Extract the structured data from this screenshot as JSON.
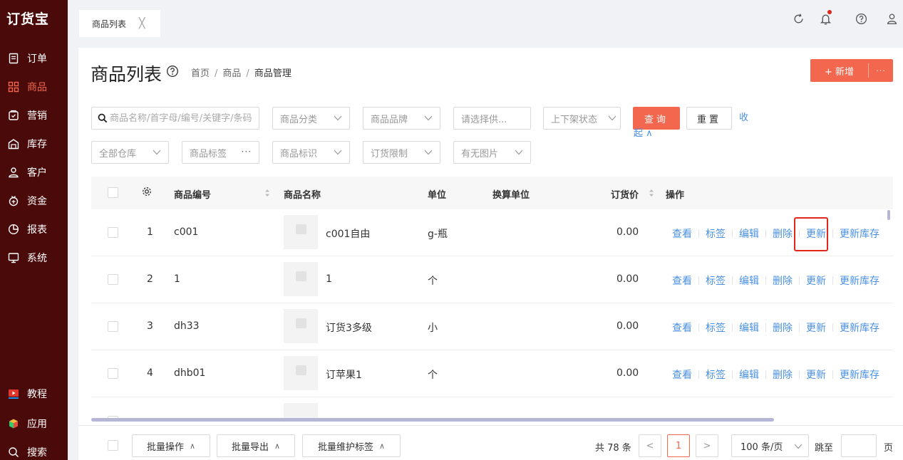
{
  "app": {
    "logo": "订货宝"
  },
  "sidebar": {
    "items": [
      {
        "label": "订单",
        "icon": "order-icon"
      },
      {
        "label": "商品",
        "icon": "goods-icon",
        "active": true
      },
      {
        "label": "营销",
        "icon": "marketing-icon"
      },
      {
        "label": "库存",
        "icon": "warehouse-icon"
      },
      {
        "label": "客户",
        "icon": "customer-icon"
      },
      {
        "label": "资金",
        "icon": "funds-icon"
      },
      {
        "label": "报表",
        "icon": "report-icon"
      },
      {
        "label": "系统",
        "icon": "system-icon"
      }
    ],
    "bottom": [
      {
        "label": "教程",
        "icon": "tutorial-icon"
      },
      {
        "label": "应用",
        "icon": "apps-icon"
      },
      {
        "label": "搜索",
        "icon": "search-icon"
      }
    ]
  },
  "tabs": [
    {
      "label": "商品列表",
      "close": "╳"
    }
  ],
  "header": {
    "title": "商品列表",
    "breadcrumb": [
      "首页",
      "商品",
      "商品管理"
    ],
    "breadcrumb_sep": "/",
    "new_button": "+ 新增",
    "more_button": "···"
  },
  "filters": {
    "search_placeholder": "商品名称/首字母/编号/关键字/条码",
    "category": "商品分类",
    "brand": "商品品牌",
    "supplier": "请选择供...",
    "shelf_status": "上下架状态",
    "warehouse": "全部仓库",
    "tags": "商品标签",
    "marks": "商品标识",
    "order_limit": "订货限制",
    "has_image": "有无图片",
    "query": "查询",
    "reset": "重置",
    "collapse": "收起 ∧"
  },
  "table": {
    "columns": {
      "code": "商品编号",
      "name": "商品名称",
      "unit": "单位",
      "conv_unit": "换算单位",
      "price": "订货价",
      "actions": "操作"
    },
    "actions": [
      "查看",
      "标签",
      "编辑",
      "删除",
      "更新",
      "更新库存"
    ],
    "rows": [
      {
        "index": "1",
        "code": "c001",
        "name": "c001自由",
        "unit": "g-瓶",
        "price": "0.00"
      },
      {
        "index": "2",
        "code": "1",
        "name": "1",
        "unit": "个",
        "price": "0.00"
      },
      {
        "index": "3",
        "code": "dh33",
        "name": "订货3多级",
        "unit": "小",
        "price": "0.00"
      },
      {
        "index": "4",
        "code": "dhb01",
        "name": "订苹果1",
        "unit": "个",
        "price": "0.00"
      }
    ]
  },
  "footer": {
    "batch_ops": "批量操作",
    "batch_export": "批量导出",
    "batch_tags": "批量维护标签",
    "total": "共 78 条",
    "prev": "<",
    "current_page": "1",
    "next": ">",
    "page_size": "100 条/页",
    "goto_label": "跳至",
    "goto_suffix": "页"
  },
  "colors": {
    "accent": "#f2674d",
    "link": "#4a90e2",
    "sidebar": "#4a0a0a",
    "highlight": "#e0271c"
  }
}
